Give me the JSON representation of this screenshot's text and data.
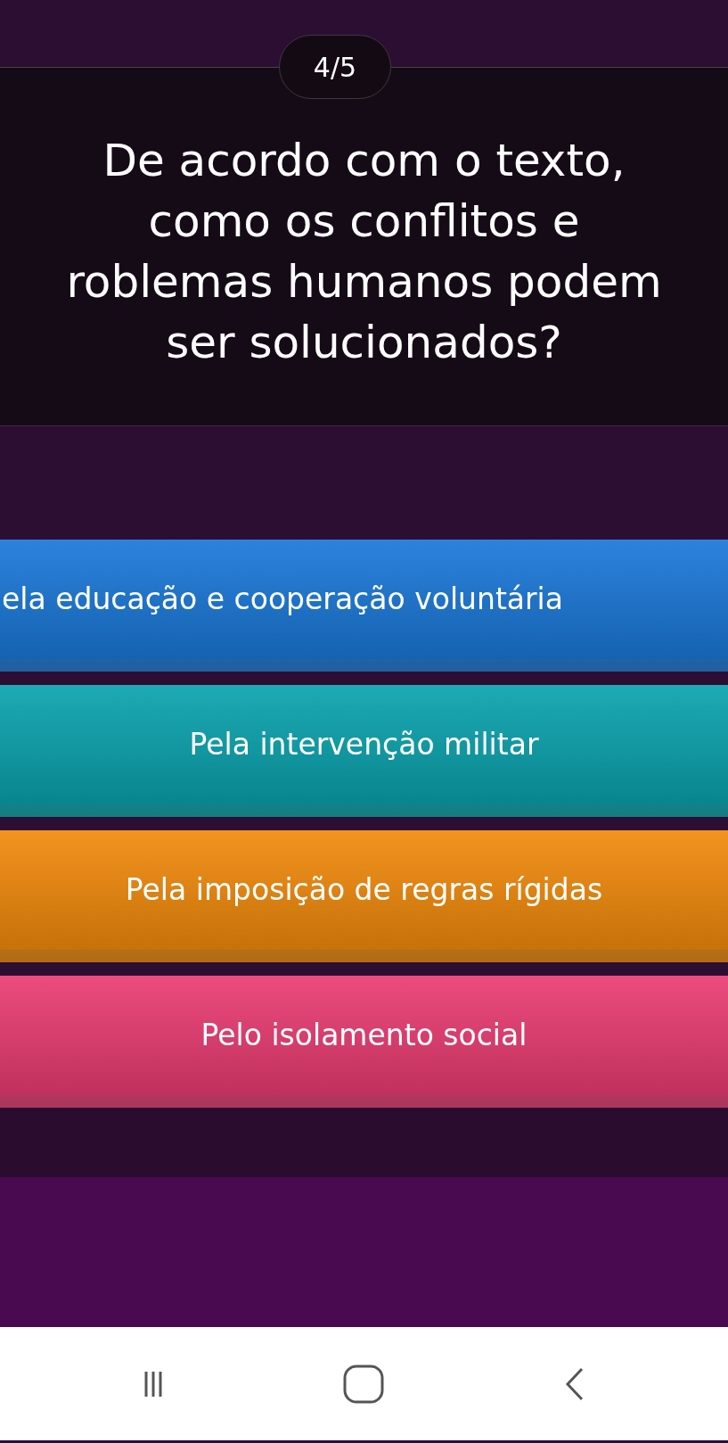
{
  "counter": "4/5",
  "question": "De acordo com o texto, como os conflitos e roblemas humanos podem ser solucionados?",
  "answers": [
    {
      "text": "ela educação e cooperação voluntária",
      "color": "#1a78d8"
    },
    {
      "text": "Pela intervenção militar",
      "color": "#0aa3ae"
    },
    {
      "text": "Pela imposição de regras rígidas",
      "color": "#f28a0c"
    },
    {
      "text": "Pelo isolamento social",
      "color": "#ea3c72"
    }
  ]
}
